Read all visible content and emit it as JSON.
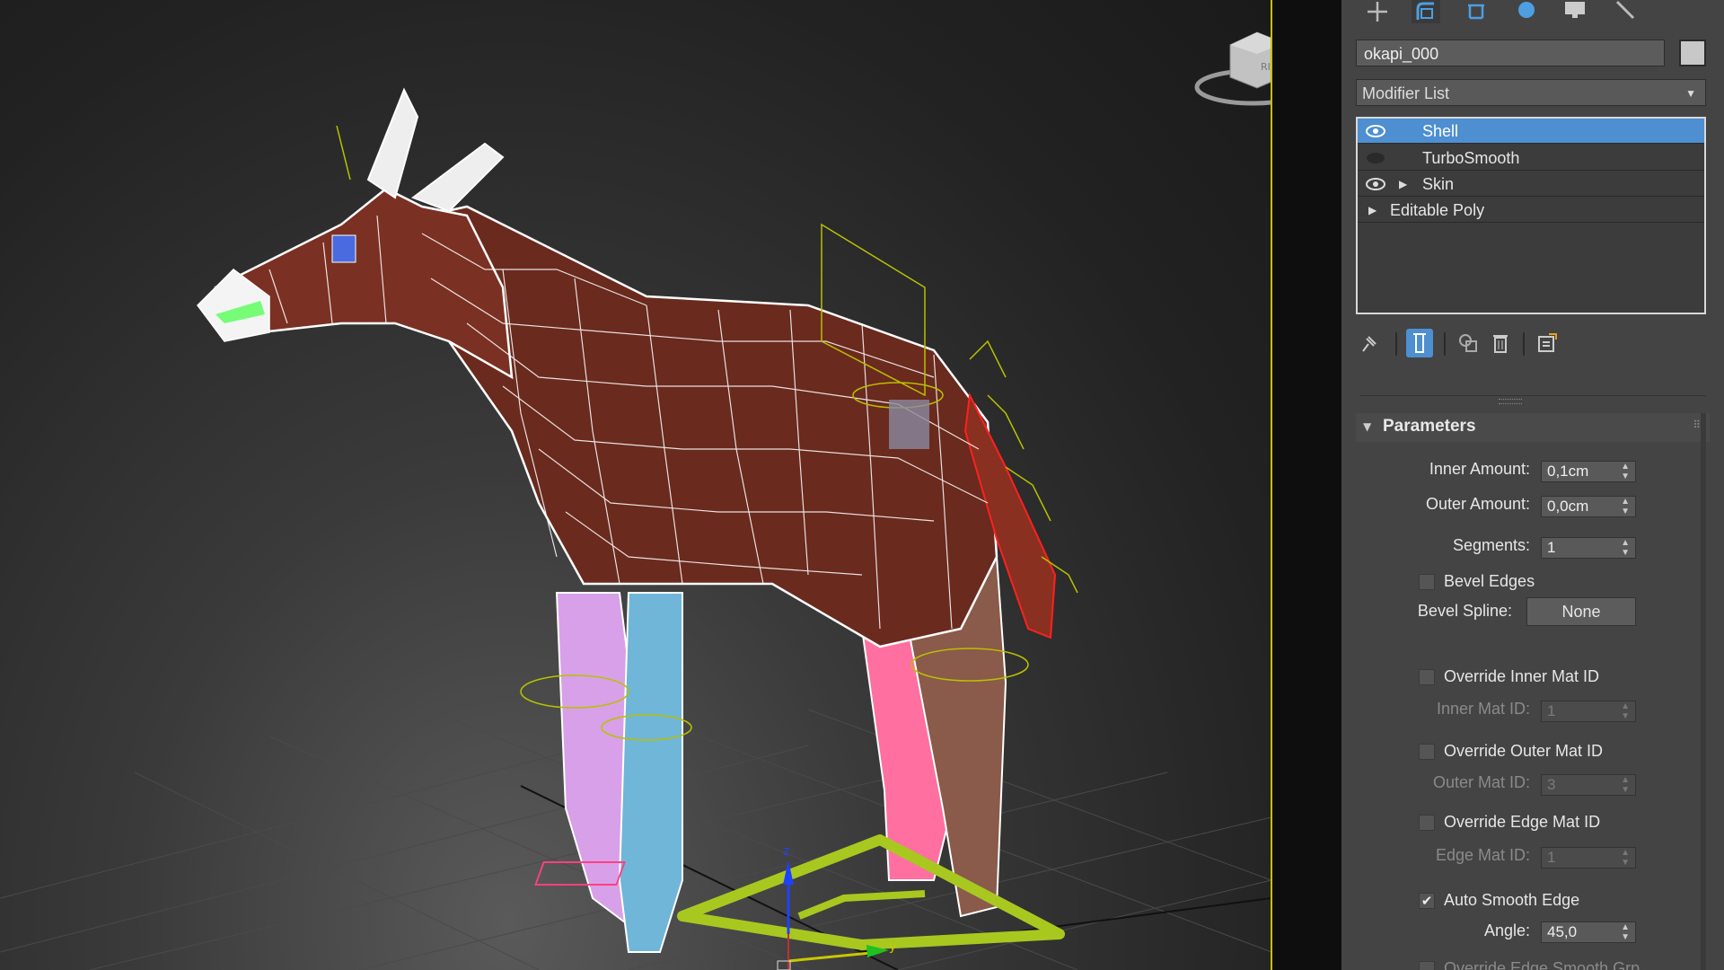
{
  "command_panel": {
    "tabs": [
      "create-icon",
      "modify-icon",
      "hierarchy-icon",
      "motion-icon",
      "display-icon",
      "utilities-icon"
    ],
    "object_name": "okapi_000",
    "object_color": "#c8c8c8",
    "modifier_list_label": "Modifier List",
    "stack": [
      {
        "label": "Shell",
        "visible": true,
        "selected": true,
        "expandable": false
      },
      {
        "label": "TurboSmooth",
        "visible": false,
        "selected": false,
        "expandable": false
      },
      {
        "label": "Skin",
        "visible": true,
        "selected": false,
        "expandable": true
      },
      {
        "label": "Editable Poly",
        "visible": null,
        "selected": false,
        "expandable": true
      }
    ],
    "stack_tools": [
      "pin-stack-icon",
      "show-end-result-icon",
      "make-unique-icon",
      "remove-modifier-icon",
      "configure-modifier-sets-icon"
    ]
  },
  "parameters": {
    "title": "Parameters",
    "inner_amount_label": "Inner Amount:",
    "inner_amount": "0,1cm",
    "outer_amount_label": "Outer Amount:",
    "outer_amount": "0,0cm",
    "segments_label": "Segments:",
    "segments": "1",
    "bevel_edges_label": "Bevel Edges",
    "bevel_edges": false,
    "bevel_spline_label": "Bevel Spline:",
    "bevel_spline_value": "None",
    "override_inner_label": "Override Inner Mat ID",
    "inner_mat_id_label": "Inner Mat ID:",
    "inner_mat_id": "1",
    "override_outer_label": "Override Outer Mat ID",
    "outer_mat_id_label": "Outer Mat ID:",
    "outer_mat_id": "3",
    "override_edge_label": "Override Edge Mat ID",
    "edge_mat_id_label": "Edge Mat ID:",
    "edge_mat_id": "1",
    "auto_smooth_label": "Auto Smooth Edge",
    "auto_smooth": true,
    "angle_label": "Angle:",
    "angle": "45,0",
    "override_smooth_label": "Override Edge Smooth Grp"
  },
  "viewport": {
    "viewcube_face": "RIGHT",
    "gizmo_axes": [
      "z",
      "y",
      "x"
    ],
    "accent_color": "#c8c000",
    "selection_color": "#4d8fd1"
  }
}
